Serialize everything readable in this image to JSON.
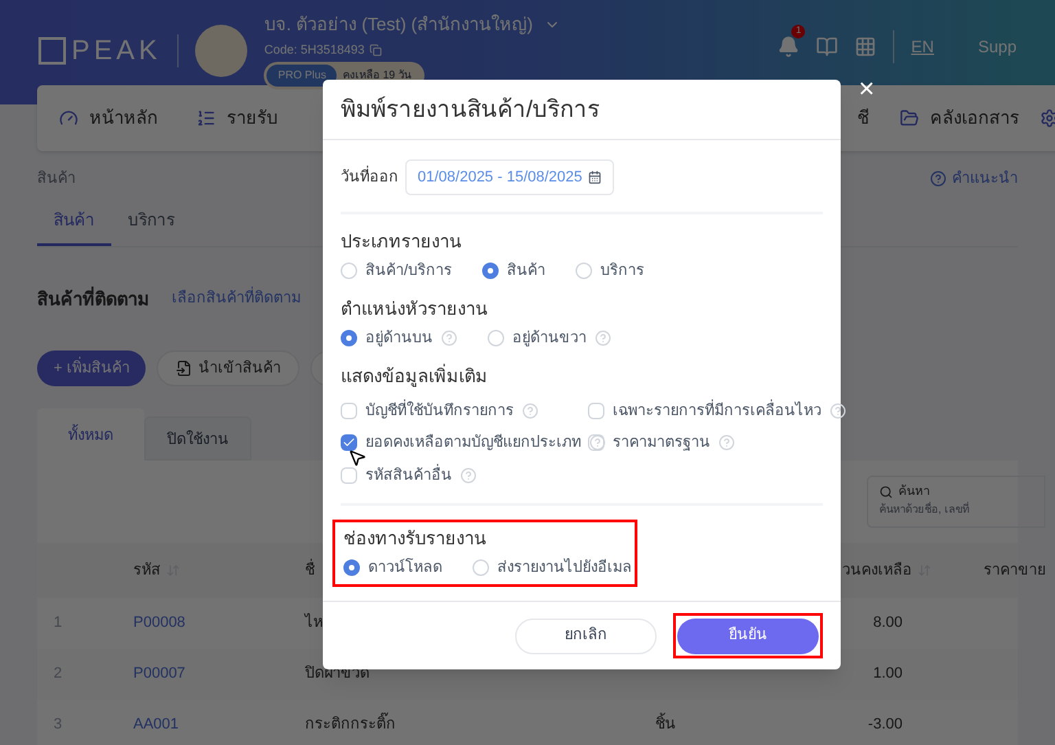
{
  "header": {
    "logo": "PEAK",
    "company": "บจ. ตัวอย่าง (Test) (สำนักงานใหญ่)",
    "code": "Code: 5H3518493",
    "plan": "PRO Plus",
    "remaining": "คงเหลือ 19 วัน",
    "notification_count": "1",
    "language": "EN",
    "support": "Supp"
  },
  "nav": [
    {
      "label": "หน้าหลัก",
      "kind": "home"
    },
    {
      "label": "รายรับ",
      "kind": "list"
    },
    {
      "label": "ชี",
      "kind": "none"
    },
    {
      "label": "คลังเอกสาร",
      "kind": "folder"
    }
  ],
  "breadcrumb": "สินค้า",
  "help_link": "คำแนะนำ",
  "page_tabs": [
    {
      "label": "สินค้า",
      "selected": true
    },
    {
      "label": "บริการ",
      "selected": false
    }
  ],
  "tracked": {
    "title": "สินค้าที่ติดตาม",
    "link": "เลือกสินค้าที่ติดตาม"
  },
  "actions": [
    {
      "label": "+ เพิ่มสินค้า",
      "kind": "primary"
    },
    {
      "label": "นำเข้าสินค้า",
      "kind": "import"
    }
  ],
  "list_tabs": [
    {
      "label": "ทั้งหมด",
      "selected": true
    },
    {
      "label": "ปิดใช้งาน",
      "selected": false
    }
  ],
  "search": {
    "label": "ค้นหา",
    "placeholder": "ค้นหาด้วยชื่อ, เลขที่"
  },
  "table": {
    "columns": [
      "รหัส",
      "ชื่",
      "วนคงเหลือ",
      "ราคาขาย"
    ],
    "rows": [
      {
        "index": "1",
        "code": "P00008",
        "name": "ไห",
        "unit": "",
        "balance": "8.00"
      },
      {
        "index": "2",
        "code": "P00007",
        "name": "ปิดฝาขวด",
        "unit": "",
        "balance": "1.00"
      },
      {
        "index": "3",
        "code": "AA001",
        "name": "กระติกกระติ๊ก",
        "unit": "ชิ้น",
        "balance": "-3.00"
      }
    ]
  },
  "dialog": {
    "title": "พิมพ์รายงานสินค้า/บริการ",
    "close": "×",
    "date": {
      "label": "วันที่ออก",
      "value": "01/08/2025 - 15/08/2025"
    },
    "sections": [
      {
        "title": "ประเภทรายงาน",
        "kind": "radio",
        "highlighted": false,
        "options": [
          {
            "label": "สินค้า/บริการ",
            "selected": false,
            "help": false
          },
          {
            "label": "สินค้า",
            "selected": true,
            "help": false
          },
          {
            "label": "บริการ",
            "selected": false,
            "help": false
          }
        ]
      },
      {
        "title": "ตำแหน่งหัวรายงาน",
        "kind": "radio",
        "highlighted": false,
        "options": [
          {
            "label": "อยู่ด้านบน",
            "selected": true,
            "help": true
          },
          {
            "label": "อยู่ด้านขวา",
            "selected": false,
            "help": true
          }
        ]
      },
      {
        "title": "แสดงข้อมูลเพิ่มเติม",
        "kind": "checkbox",
        "highlighted": false,
        "options": [
          {
            "label": "บัญชีที่ใช้บันทึกรายการ",
            "checked": false,
            "help": true
          },
          {
            "label": "เฉพาะรายการที่มีการเคลื่อนไหว",
            "checked": false,
            "help": true
          },
          {
            "label": "ยอดคงเหลือตามบัญชีแยกประเภท",
            "checked": true,
            "help": true
          },
          {
            "label": "ราคามาตรฐาน",
            "checked": false,
            "help": true
          },
          {
            "label": "รหัสสินค้าอื่น",
            "checked": false,
            "help": true
          }
        ]
      },
      {
        "title": "ช่องทางรับรายงาน",
        "kind": "radio",
        "highlighted": true,
        "options": [
          {
            "label": "ดาวน์โหลด",
            "selected": true,
            "help": false
          },
          {
            "label": "ส่งรายงานไปยังอีเมล",
            "selected": false,
            "help": false
          }
        ]
      }
    ],
    "buttons": [
      {
        "label": "ยกเลิก",
        "kind": "secondary",
        "highlighted": false
      },
      {
        "label": "ยืนยัน",
        "kind": "primary",
        "highlighted": true
      }
    ]
  }
}
